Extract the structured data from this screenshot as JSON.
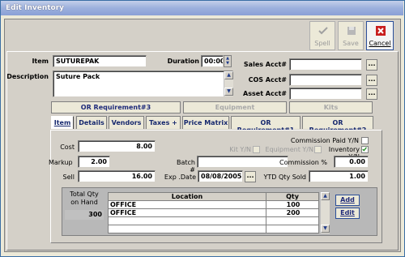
{
  "window": {
    "title": "Edit Inventory"
  },
  "toolbar": {
    "spell_label": "Spell",
    "save_label": "Save",
    "cancel_label": "Cancel"
  },
  "header": {
    "item_label": "Item",
    "item_value": "SUTUREPAK",
    "duration_label": "Duration",
    "duration_value": "00:00",
    "description_label": "Description",
    "description_value": "Suture Pack",
    "sales_acct_label": "Sales Acct#",
    "sales_acct_value": "",
    "cos_acct_label": "COS Acct#",
    "cos_acct_value": "",
    "asset_acct_label": "Asset Acct#",
    "asset_acct_value": "",
    "dots": "..."
  },
  "top_tabs": [
    {
      "label": "OR Requirement#3",
      "state": "selected"
    },
    {
      "label": "Equipment",
      "state": "disabled"
    },
    {
      "label": "Kits",
      "state": "disabled"
    }
  ],
  "tabs": [
    "Item",
    "Details",
    "Vendors",
    "Taxes +",
    "Price Matrix",
    "OR Requirement#1",
    "OR Requirement#2"
  ],
  "item_tab": {
    "cost_label": "Cost",
    "cost_value": "8.00",
    "markup_label": "Markup",
    "markup_value": "2.00",
    "sell_label": "Sell",
    "sell_value": "16.00",
    "batch_label": "Batch #",
    "batch_value": "",
    "exp_date_label": "Exp .Date",
    "exp_date_value": "08/08/2005",
    "ytd_label": "YTD Qty Sold",
    "ytd_value": "1.00",
    "commission_paid_label": "Commission Paid Y/N",
    "kit_label": "Kit Y/N",
    "equipment_label": "Equipment Y/N",
    "inventory_label": "Inventory Y/N",
    "commission_pct_label": "Commission %",
    "commission_pct_value": "0.00"
  },
  "stock": {
    "total_label_1": "Total Qty",
    "total_label_2": "on Hand",
    "total_value": "300",
    "col_location": "Location",
    "col_qty": "Qty",
    "rows": [
      {
        "location": "OFFICE",
        "qty": "100"
      },
      {
        "location": "OFFICE",
        "qty": "200"
      }
    ],
    "add_label": "Add",
    "edit_label": "Edit"
  }
}
